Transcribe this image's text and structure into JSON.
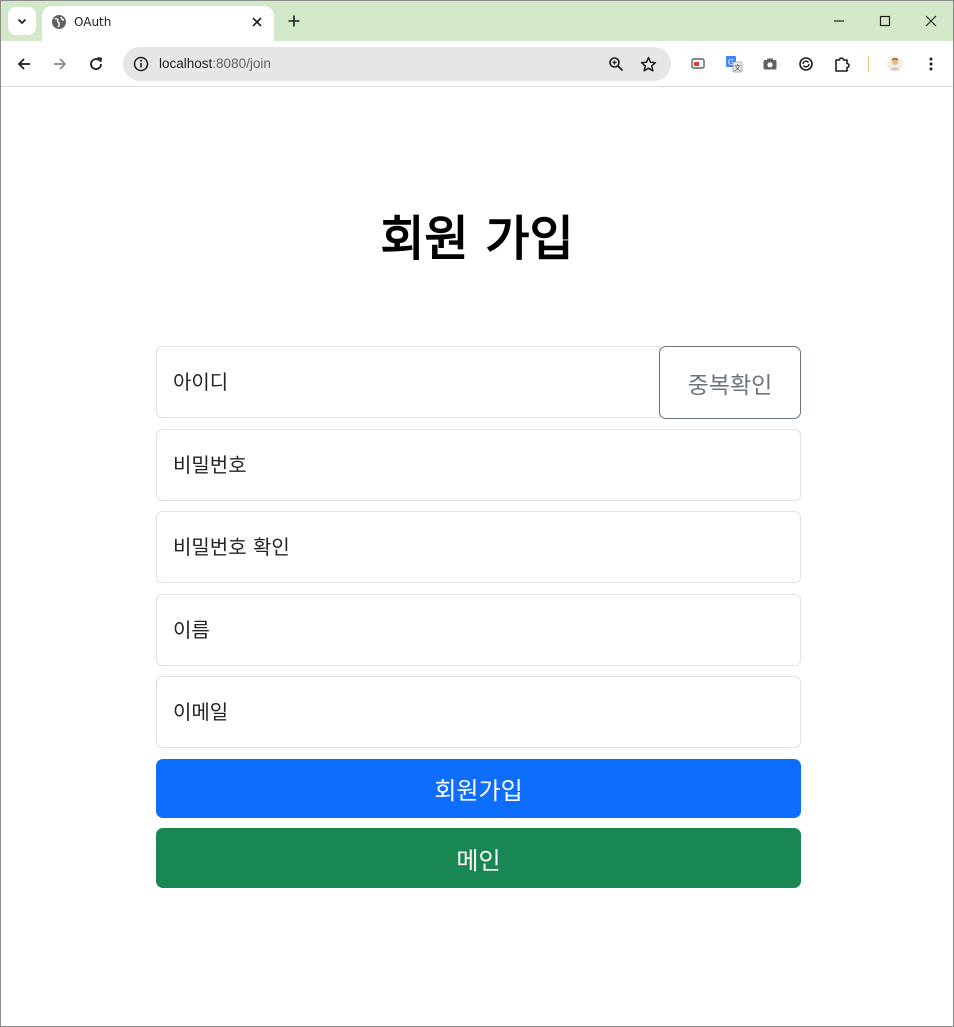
{
  "browser": {
    "tab_title": "OAuth",
    "url_host": "localhost",
    "url_rest": ":8080/join"
  },
  "page": {
    "heading": "회원 가입",
    "fields": {
      "id_placeholder": "아이디",
      "password_placeholder": "비밀번호",
      "password_confirm_placeholder": "비밀번호 확인",
      "name_placeholder": "이름",
      "email_placeholder": "이메일"
    },
    "duplicate_check_label": "중복확인",
    "join_button_label": "회원가입",
    "main_button_label": "메인"
  },
  "colors": {
    "tabstrip_bg": "#d3e8c9",
    "primary": "#0d6efd",
    "success": "#198754",
    "secondary": "#6c757d"
  }
}
